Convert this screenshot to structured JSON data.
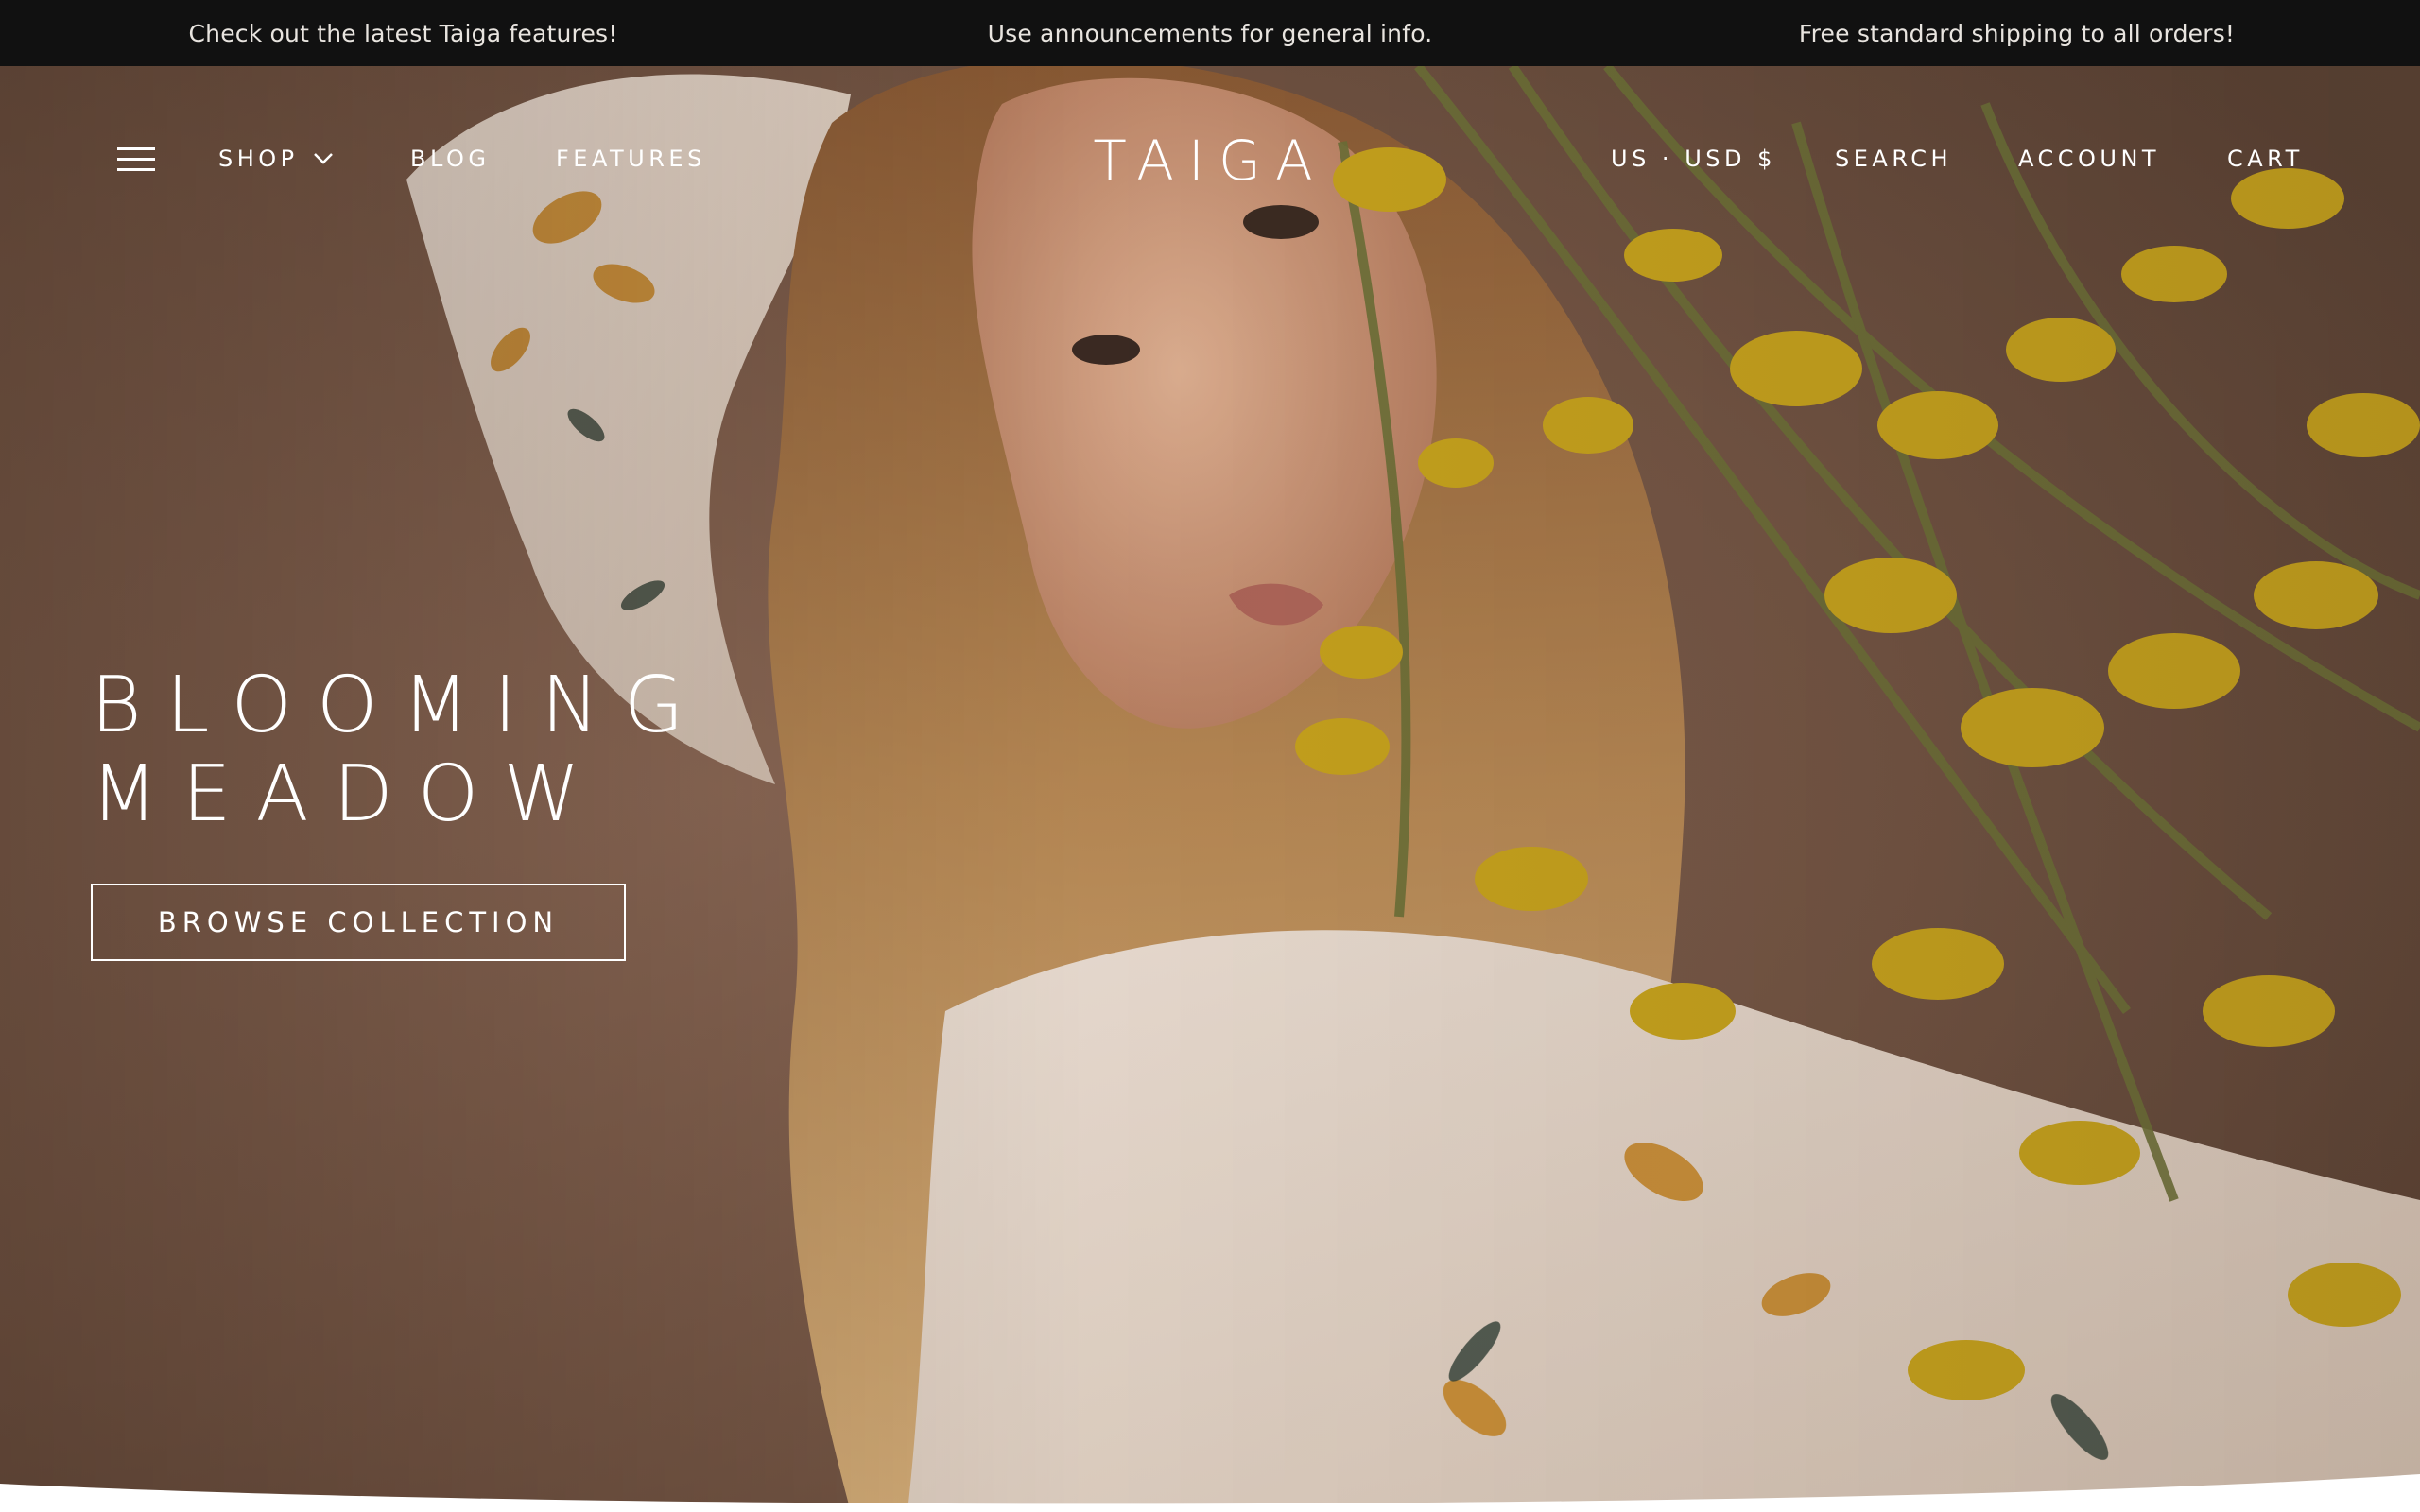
{
  "announcements": [
    "Check out the latest Taiga features!",
    "Use announcements for general info.",
    "Free standard shipping to all orders!"
  ],
  "header": {
    "logo": "TAIGA",
    "nav_left": {
      "menu_icon": "hamburger-menu-icon",
      "shop": "SHOP",
      "shop_icon": "chevron-down-icon",
      "blog": "BLOG",
      "features": "FEATURES"
    },
    "nav_right": {
      "currency": "US · USD $",
      "search": "SEARCH",
      "account": "ACCOUNT",
      "cart": "CART"
    }
  },
  "hero": {
    "title_line1": "BLOOMING",
    "title_line2": "MEADOW",
    "cta": "BROWSE COLLECTION",
    "image_description_icon": "hero-photo-woman-with-yellow-flowers"
  },
  "colors": {
    "announcement_bg": "#111111",
    "announcement_text": "#e8e4df",
    "hero_bg": "#7a5c4c",
    "text_light": "#ffffff",
    "flower_yellow": "#c9a51c",
    "page_bg": "#ffffff"
  }
}
